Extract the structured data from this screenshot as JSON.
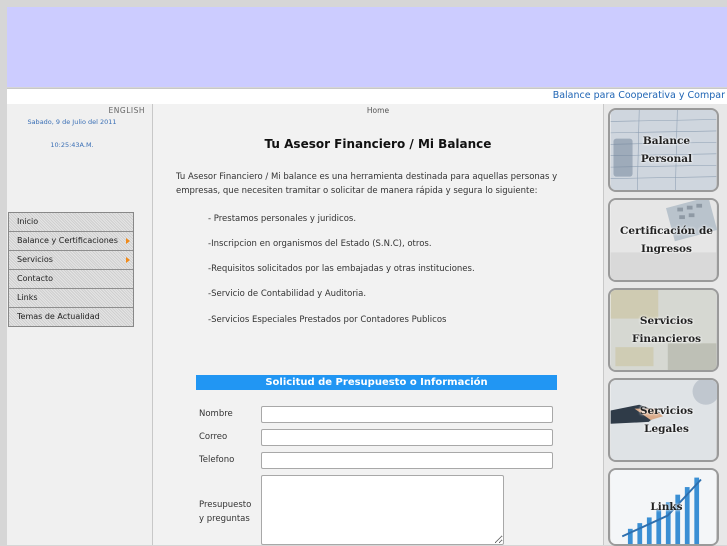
{
  "ticker": {
    "text": "Balance para Cooperativa y Compar"
  },
  "sidebar": {
    "language_link": "ENGLISH",
    "date": "Sabado, 9 de Julio del 2011",
    "time": "10:25:43A.M.",
    "menu": [
      {
        "label": "Inicio",
        "has_submenu": false
      },
      {
        "label": "Balance y Certificaciones",
        "has_submenu": true
      },
      {
        "label": "Servicios",
        "has_submenu": true
      },
      {
        "label": "Contacto",
        "has_submenu": false
      },
      {
        "label": "Links",
        "has_submenu": false
      },
      {
        "label": "Temas de Actualidad",
        "has_submenu": false
      }
    ]
  },
  "main": {
    "breadcrumb": "Home",
    "title": "Tu Asesor Financiero / Mi Balance",
    "intro": "Tu Asesor Financiero / Mi balance es una herramienta destinada para aquellas personas y empresas, que necesiten tramitar o solicitar de manera rápida y segura lo siguiente:",
    "services": [
      "- Prestamos personales y juridicos.",
      "-Inscripcion en organismos del Estado (S.N.C), otros.",
      "-Requisitos solicitados por las embajadas y otras instituciones.",
      "-Servicio de Contabilidad y Auditoria.",
      "-Servicios Especiales Prestados por Contadores Publicos"
    ]
  },
  "form": {
    "header": "Solicitud de Presupuesto o Información",
    "fields": {
      "nombre": {
        "label": "Nombre",
        "value": ""
      },
      "correo": {
        "label": "Correo",
        "value": ""
      },
      "telefono": {
        "label": "Telefono",
        "value": ""
      },
      "presupuesto": {
        "label_line1": "Presupuesto",
        "label_line2": "y preguntas",
        "value": ""
      }
    }
  },
  "right_tiles": [
    {
      "line1": "Balance",
      "line2": "Personal",
      "icon": "balance-sheet-image"
    },
    {
      "line1": "Certificación de",
      "line2": "Ingresos",
      "icon": "calculator-image"
    },
    {
      "line1": "Servicios",
      "line2": "Financieros",
      "icon": "money-image"
    },
    {
      "line1": "Servicios",
      "line2": "Legales",
      "icon": "handshake-image"
    },
    {
      "line1": "Links",
      "line2": "",
      "icon": "growth-chart-image"
    }
  ],
  "colors": {
    "banner": "#ccccff",
    "form_header": "#2196f3",
    "ticker_text": "#1e64b4",
    "date_text": "#3a6fb5",
    "menu_arrow": "#f08a1a"
  }
}
